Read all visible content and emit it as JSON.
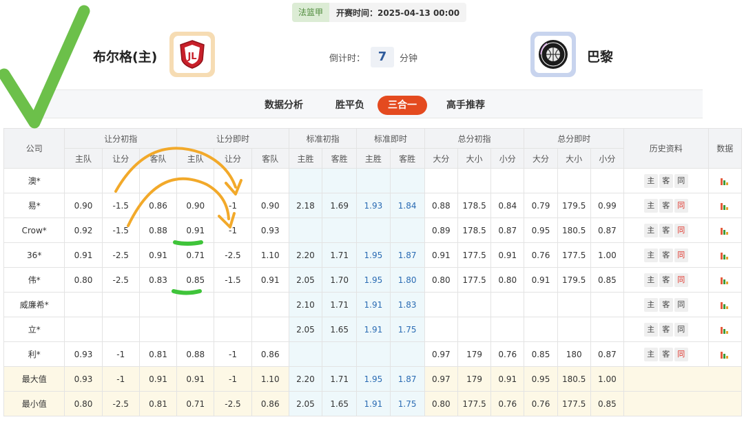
{
  "header": {
    "league": "法篮甲",
    "match_time": "开赛时间：2025-04-13 00:00",
    "home_team": "布尔格(主)",
    "away_team": "巴黎",
    "countdown_prefix": "倒计时：",
    "countdown_value": "7",
    "countdown_unit": "分钟"
  },
  "tabs": [
    {
      "label": "数据分析",
      "active": false
    },
    {
      "label": "胜平负",
      "active": false
    },
    {
      "label": "三合一",
      "active": true
    },
    {
      "label": "高手推荐",
      "active": false
    }
  ],
  "table": {
    "col_company": "公司",
    "groups": [
      "让分初指",
      "让分即时",
      "标准初指",
      "标准即时",
      "总分初指",
      "总分即时"
    ],
    "col_history": "历史资料",
    "col_data": "数据",
    "sub_headers": [
      "主队",
      "让分",
      "客队",
      "主队",
      "让分",
      "客队",
      "主胜",
      "客胜",
      "主胜",
      "客胜",
      "大分",
      "大小",
      "小分",
      "大分",
      "大小",
      "小分"
    ],
    "history_buttons": [
      "主",
      "客",
      "同"
    ],
    "rows": [
      {
        "company": "澳*",
        "values": [
          "",
          "",
          "",
          "",
          "",
          "",
          "",
          "",
          "",
          "",
          "",
          "",
          "",
          "",
          "",
          ""
        ],
        "tong_red": false
      },
      {
        "company": "易*",
        "values": [
          "0.90",
          "-1.5",
          "0.86",
          "0.90",
          "-1",
          "0.90",
          "2.18",
          "1.69",
          "1.93",
          "1.84",
          "0.88",
          "178.5",
          "0.84",
          "0.79",
          "179.5",
          "0.99"
        ],
        "tong_red": true
      },
      {
        "company": "Crow*",
        "values": [
          "0.92",
          "-1.5",
          "0.88",
          "0.91",
          "-1",
          "0.93",
          "",
          "",
          "",
          "",
          "0.89",
          "178.5",
          "0.87",
          "0.95",
          "180.5",
          "0.87"
        ],
        "tong_red": true
      },
      {
        "company": "36*",
        "values": [
          "0.91",
          "-2.5",
          "0.91",
          "0.71",
          "-2.5",
          "1.10",
          "2.20",
          "1.71",
          "1.95",
          "1.87",
          "0.91",
          "177.5",
          "0.91",
          "0.76",
          "177.5",
          "1.00"
        ],
        "tong_red": true
      },
      {
        "company": "伟*",
        "values": [
          "0.80",
          "-2.5",
          "0.83",
          "0.85",
          "-1.5",
          "0.91",
          "2.05",
          "1.70",
          "1.95",
          "1.80",
          "0.80",
          "177.5",
          "0.80",
          "0.91",
          "179.5",
          "0.85"
        ],
        "tong_red": true
      },
      {
        "company": "威廉希*",
        "values": [
          "",
          "",
          "",
          "",
          "",
          "",
          "2.10",
          "1.71",
          "1.91",
          "1.83",
          "",
          "",
          "",
          "",
          "",
          ""
        ],
        "tong_red": false
      },
      {
        "company": "立*",
        "values": [
          "",
          "",
          "",
          "",
          "",
          "",
          "2.05",
          "1.65",
          "1.91",
          "1.75",
          "",
          "",
          "",
          "",
          "",
          ""
        ],
        "tong_red": false
      },
      {
        "company": "利*",
        "values": [
          "0.93",
          "-1",
          "0.81",
          "0.88",
          "-1",
          "0.86",
          "",
          "",
          "",
          "",
          "0.97",
          "179",
          "0.76",
          "0.85",
          "180",
          "0.87"
        ],
        "tong_red": true
      }
    ],
    "summary": [
      {
        "label": "最大值",
        "values": [
          "0.93",
          "-1",
          "0.91",
          "0.91",
          "-1",
          "1.10",
          "2.20",
          "1.71",
          "1.95",
          "1.87",
          "0.97",
          "179",
          "0.91",
          "0.95",
          "180.5",
          "1.00"
        ]
      },
      {
        "label": "最小值",
        "values": [
          "0.80",
          "-2.5",
          "0.81",
          "0.71",
          "-2.5",
          "0.86",
          "2.05",
          "1.65",
          "1.91",
          "1.75",
          "0.80",
          "177.5",
          "0.76",
          "0.76",
          "177.5",
          "0.85"
        ]
      }
    ]
  },
  "colors": {
    "accent_tab": "#e44a1f",
    "instant_value": "#2a6bb3",
    "standard_column_bg": "#eef8fb",
    "summary_bg": "#fdf8e6",
    "annotation_check": "#6cc04a",
    "annotation_arrow": "#f2a92a",
    "annotation_mark": "#3fc43a"
  },
  "icons": {
    "home_logo": "team-crest-icon",
    "away_logo": "basketball-crest-icon",
    "data_column": "bar-chart-icon",
    "annotation_check": "checkmark-icon"
  }
}
